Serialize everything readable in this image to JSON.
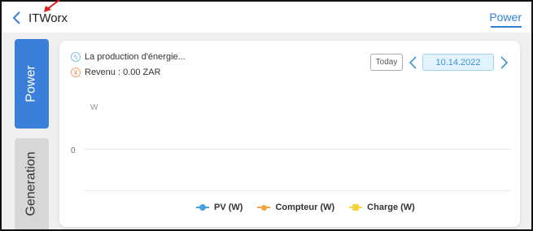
{
  "header": {
    "title": "ITWorx",
    "active_tab": "Power"
  },
  "sidebar": {
    "tabs": [
      {
        "label": "Power",
        "active": true
      },
      {
        "label": "Generation",
        "active": false
      }
    ]
  },
  "card": {
    "energy_label": "La production d'énergie...",
    "revenue_label": "Revenu : 0.00 ZAR",
    "today_label": "Today",
    "date": "10.14.2022",
    "y_unit": "W",
    "y_zero": "0"
  },
  "chart_data": {
    "type": "line",
    "series": [
      {
        "name": "PV (W)",
        "color": "#4aa3df",
        "values": []
      },
      {
        "name": "Compteur (W)",
        "color": "#f2a641",
        "values": []
      },
      {
        "name": "Charge (W)",
        "color": "#f5d440",
        "values": []
      }
    ],
    "ylabel": "W",
    "y_ticks": [
      "0"
    ],
    "legend_position": "bottom"
  },
  "colors": {
    "accent": "#3a7fd9",
    "tab_link": "#2f7fd6"
  },
  "icons": {
    "back": "chevron-left-icon",
    "energy": "energy-icon",
    "revenue": "yen-icon",
    "date_prev": "chevron-left-icon",
    "date_next": "chevron-right-icon"
  }
}
